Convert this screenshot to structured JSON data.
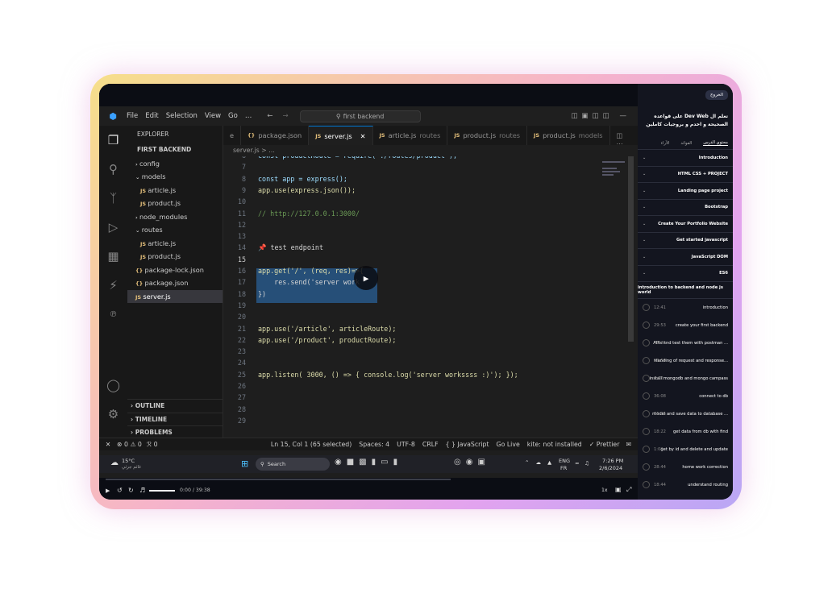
{
  "vscode": {
    "menu": [
      "File",
      "Edit",
      "Selection",
      "View",
      "Go",
      "…"
    ],
    "search": "first backend",
    "explorer_title": "EXPLORER",
    "project": "FIRST BACKEND",
    "tree": [
      {
        "label": "config",
        "kind": "folder",
        "depth": 1
      },
      {
        "label": "models",
        "kind": "folder-open",
        "depth": 1
      },
      {
        "label": "article.js",
        "kind": "js",
        "depth": 2
      },
      {
        "label": "product.js",
        "kind": "js",
        "depth": 2
      },
      {
        "label": "node_modules",
        "kind": "folder",
        "depth": 1
      },
      {
        "label": "routes",
        "kind": "folder-open",
        "depth": 1
      },
      {
        "label": "article.js",
        "kind": "js",
        "depth": 2
      },
      {
        "label": "product.js",
        "kind": "js",
        "depth": 2
      },
      {
        "label": "package-lock.json",
        "kind": "json",
        "depth": 1
      },
      {
        "label": "package.json",
        "kind": "json",
        "depth": 1
      },
      {
        "label": "server.js",
        "kind": "js",
        "depth": 1,
        "selected": true
      }
    ],
    "outline": "OUTLINE",
    "timeline": "TIMELINE",
    "problems": "PROBLEMS",
    "tabs": [
      {
        "icon": "",
        "label": "e",
        "sub": ""
      },
      {
        "icon": "{}",
        "label": "package.json",
        "sub": ""
      },
      {
        "icon": "JS",
        "label": "server.js",
        "sub": "",
        "active": true
      },
      {
        "icon": "JS",
        "label": "article.js",
        "sub": "routes"
      },
      {
        "icon": "JS",
        "label": "product.js",
        "sub": "routes"
      },
      {
        "icon": "JS",
        "label": "product.js",
        "sub": "models"
      }
    ],
    "breadcrumb": "server.js > …",
    "code": [
      {
        "n": "6",
        "t": "const productRoute = require('./routes/product');"
      },
      {
        "n": "7",
        "t": ""
      },
      {
        "n": "8",
        "t": "const app = express();"
      },
      {
        "n": "9",
        "t": "app.use(express.json());"
      },
      {
        "n": "10",
        "t": ""
      },
      {
        "n": "11",
        "t": "// http://127.0.0.1:3000/"
      },
      {
        "n": "12",
        "t": ""
      },
      {
        "n": "13",
        "t": ""
      },
      {
        "n": "14",
        "t": "📌 test endpoint"
      },
      {
        "n": "15",
        "t": ""
      },
      {
        "n": "16",
        "t": "app.get('/', (req, res)=>{"
      },
      {
        "n": "17",
        "t": "    res.send('server work"
      },
      {
        "n": "18",
        "t": "})"
      },
      {
        "n": "19",
        "t": ""
      },
      {
        "n": "20",
        "t": ""
      },
      {
        "n": "21",
        "t": "app.use('/article', articleRoute);"
      },
      {
        "n": "22",
        "t": "app.use('/product', productRoute);"
      },
      {
        "n": "23",
        "t": ""
      },
      {
        "n": "24",
        "t": ""
      },
      {
        "n": "25",
        "t": "app.listen( 3000, () => { console.log('server workssss :)'); });"
      },
      {
        "n": "26",
        "t": ""
      },
      {
        "n": "27",
        "t": ""
      },
      {
        "n": "28",
        "t": ""
      },
      {
        "n": "29",
        "t": ""
      }
    ],
    "status": {
      "problems": "⊗ 0 ⚠ 0",
      "ports": "&#x1F4E1; 0",
      "position": "Ln 15, Col 1 (65 selected)",
      "spaces": "Spaces: 4",
      "encoding": "UTF-8",
      "eol": "CRLF",
      "lang": "{ } JavaScript",
      "live": "Go Live",
      "kite": "kite: not installed",
      "prettier": "✓ Prettier"
    }
  },
  "taskbar": {
    "temp": "15°C",
    "weather": "غائم جزئي",
    "search": "Search",
    "lang": "ENG",
    "lang2": "FR",
    "time": "7:26 PM",
    "date": "2/6/2024"
  },
  "player": {
    "time": "0:00 / 39:38",
    "speed": "1x",
    "progress": 0
  },
  "course": {
    "back": "الخروج",
    "title": "تعلم ال Dev Web على قواعده الصحيحة و اخدم و بروجيات كاملين",
    "tabs": [
      "محتوي الدرس",
      "الفوائد",
      "الآراء"
    ],
    "sections": [
      "Introduction",
      "HTML CSS + PROJECT",
      "Landing page project",
      "Bootstrap",
      "Create Your Portfolio Website",
      "Get started javascript",
      "JavaScript DOM",
      "ES6",
      "introduction to backend and node js world"
    ],
    "lessons": [
      {
        "d": "12:41",
        "t": "introduction"
      },
      {
        "d": "29:53",
        "t": "create your first backend"
      },
      {
        "d": "49:45",
        "t": "APIs and test them with postman ..."
      },
      {
        "d": "59:50",
        "t": "standing of request and response..."
      },
      {
        "d": "2:02",
        "t": "install mongodb and mongo campass"
      },
      {
        "d": "36:08",
        "t": "connect to db"
      },
      {
        "d": "31:06",
        "t": "model and save data to database ..."
      },
      {
        "d": "18:22",
        "t": "get data from db with find"
      },
      {
        "d": "1:02",
        "t": "get by id and delete and update"
      },
      {
        "d": "28:44",
        "t": "home work correction"
      },
      {
        "d": "18:44",
        "t": "understand routing"
      }
    ]
  }
}
